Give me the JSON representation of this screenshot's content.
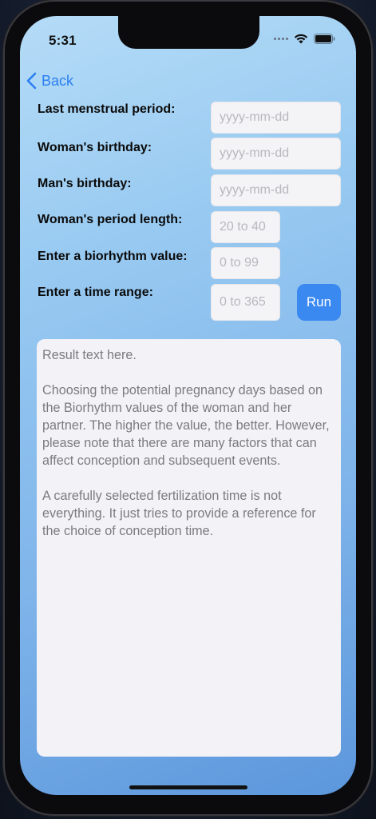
{
  "status_bar": {
    "time": "5:31"
  },
  "nav": {
    "back_label": "Back"
  },
  "form": {
    "last_period": {
      "label": "Last menstrual period:",
      "placeholder": "yyyy-mm-dd"
    },
    "woman_birthday": {
      "label": "Woman's birthday:",
      "placeholder": "yyyy-mm-dd"
    },
    "man_birthday": {
      "label": "Man's birthday:",
      "placeholder": "yyyy-mm-dd"
    },
    "period_length": {
      "label": "Woman's period length:",
      "placeholder": "20 to 40"
    },
    "biorhythm_value": {
      "label": "Enter a biorhythm value:",
      "placeholder": "0 to 99"
    },
    "time_range": {
      "label": "Enter a time range:",
      "placeholder": "0 to 365"
    },
    "run_label": "Run"
  },
  "result": {
    "text": "Result text here.\n\nChoosing the potential pregnancy days based on the Biorhythm values of the woman and her partner. The higher the value, the better. However, please note that there are many factors that can affect conception and subsequent events.\n\nA carefully selected fertilization time is not everything. It just tries to provide a reference for the choice of conception time."
  },
  "colors": {
    "accent": "#3a89f0",
    "back_link": "#2b7ff0",
    "field_bg": "#f4f4f7"
  }
}
